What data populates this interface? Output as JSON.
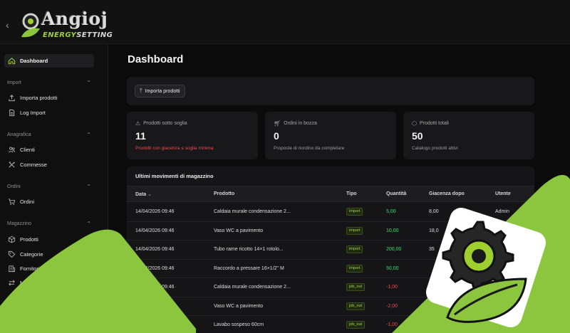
{
  "brand": {
    "logo_top": "Angioj",
    "logo_bottom_e": "ENERGY",
    "logo_bottom_rest": "SETTING"
  },
  "colors": {
    "accent": "#9fcf2e",
    "danger": "#ef4b4b",
    "positive": "#4bd17a",
    "deco_green": "#8cc63f"
  },
  "sidebar": {
    "dashboard": "Dashboard",
    "sections": [
      {
        "title": "Import",
        "items": [
          "Importa prodotti",
          "Log Import"
        ]
      },
      {
        "title": "Anagrafica",
        "items": [
          "Clienti",
          "Commesse"
        ]
      },
      {
        "title": "Ordini",
        "items": [
          "Ordini"
        ]
      },
      {
        "title": "Magazzino",
        "items": [
          "Prodotti",
          "Categorie",
          "Fornitori",
          "Movimenti"
        ]
      }
    ]
  },
  "main": {
    "title": "Dashboard",
    "import_button": "Importa prodotti",
    "stats": [
      {
        "label": "Prodotti sotto soglia",
        "value": "11",
        "sub": "Prodotti con giacenza ≤ soglia minima",
        "icon": "warning-icon"
      },
      {
        "label": "Ordini in bozza",
        "value": "0",
        "sub": "Proposte di riordino da completare",
        "icon": "cart-icon"
      },
      {
        "label": "Prodotti totali",
        "value": "50",
        "sub": "Catalogo prodotti attivi",
        "icon": "box-icon"
      }
    ],
    "table": {
      "title": "Ultimi movimenti di magazzino",
      "columns": [
        "Data",
        "Prodotto",
        "Tipo",
        "Quantità",
        "Giacenza dopo",
        "Utente"
      ],
      "rows": [
        {
          "date": "14/04/2026 09:46",
          "product": "Caldaia murale condensazione 2...",
          "type": "import",
          "qty": "5,00",
          "stock": "8,00",
          "user": "Admin"
        },
        {
          "date": "14/04/2026 09:46",
          "product": "Vaso WC a pavimento",
          "type": "import",
          "qty": "10,00",
          "stock": "18,0",
          "user": ""
        },
        {
          "date": "14/04/2026 09:46",
          "product": "Tubo rame ricotto 14×1 rotolo...",
          "type": "import",
          "qty": "200,00",
          "stock": "35",
          "user": ""
        },
        {
          "date": "14/04/2026 09:46",
          "product": "Raccordo a pressare 16×1/2\" M",
          "type": "import",
          "qty": "50,00",
          "stock": "",
          "user": ""
        },
        {
          "date": "14/04/2026 09:46",
          "product": "Caldaia murale condensazione 2...",
          "type": "job_out",
          "qty": "-1,00",
          "stock": "7,",
          "user": ""
        },
        {
          "date": "",
          "product": "Vaso WC a pavimento",
          "type": "job_out",
          "qty": "-2,00",
          "stock": "",
          "user": ""
        },
        {
          "date": "",
          "product": "Lavabo sospeso 60cm",
          "type": "job_out",
          "qty": "-1,00",
          "stock": "",
          "user": ""
        }
      ]
    }
  }
}
